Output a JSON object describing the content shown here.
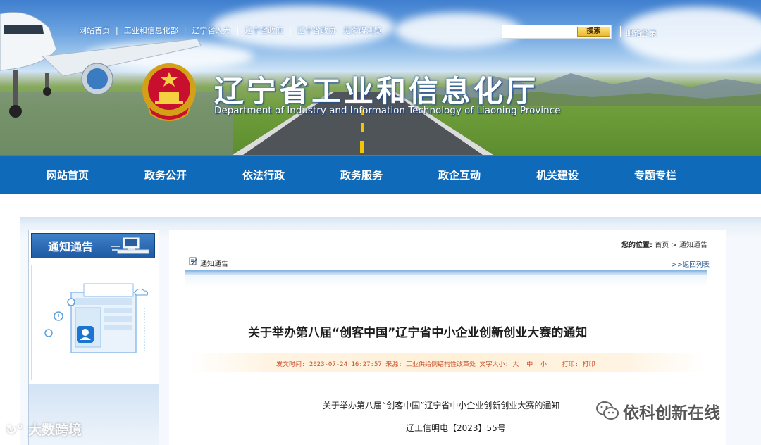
{
  "header": {
    "top_links": [
      "网站首页",
      "工业和信息化部",
      "辽宁省人大",
      "辽宁省政府",
      "辽宁省政协",
      "无障碍浏览"
    ],
    "search_button": "搜索",
    "mail_link": "邮箱登录",
    "site_title": "辽宁省工业和信息化厅",
    "site_subtitle": "Department of Industry and Information Technology of Liaoning Province"
  },
  "nav": {
    "items": [
      "网站首页",
      "政务公开",
      "依法行政",
      "政务服务",
      "政企互动",
      "机关建设",
      "专题专栏"
    ]
  },
  "sidebar": {
    "heading": "通知通告"
  },
  "article": {
    "breadcrumb_prefix": "您的位置:",
    "breadcrumb_home": "首页",
    "breadcrumb_sep": " > ",
    "breadcrumb_current": "通知通告",
    "column_label": "通知通告",
    "back_link": ">>返回列表",
    "title": "关于举办第八届“创客中国”辽宁省中小企业创新创业大赛的通知",
    "meta_time": "发文时间: 2023-07-24 16:27:57",
    "meta_source": "来源: 工业供给侧结构性改革处",
    "meta_fontsize_label": "文字大小:",
    "meta_large": "大",
    "meta_medium": "中",
    "meta_small": "小",
    "meta_print_label": "打印:",
    "meta_print": "打印",
    "body_line1": "关于举办第八届“创客中国”辽宁省中小企业创新创业大赛的通知",
    "body_line2": "辽工信明电【2023】55号"
  },
  "watermarks": {
    "left": "大数跨境",
    "right": "依科创新在线"
  },
  "colors": {
    "nav_blue": "#0f6aba",
    "meta_red": "#c94b2a",
    "link_blue": "#1f4e8c"
  }
}
